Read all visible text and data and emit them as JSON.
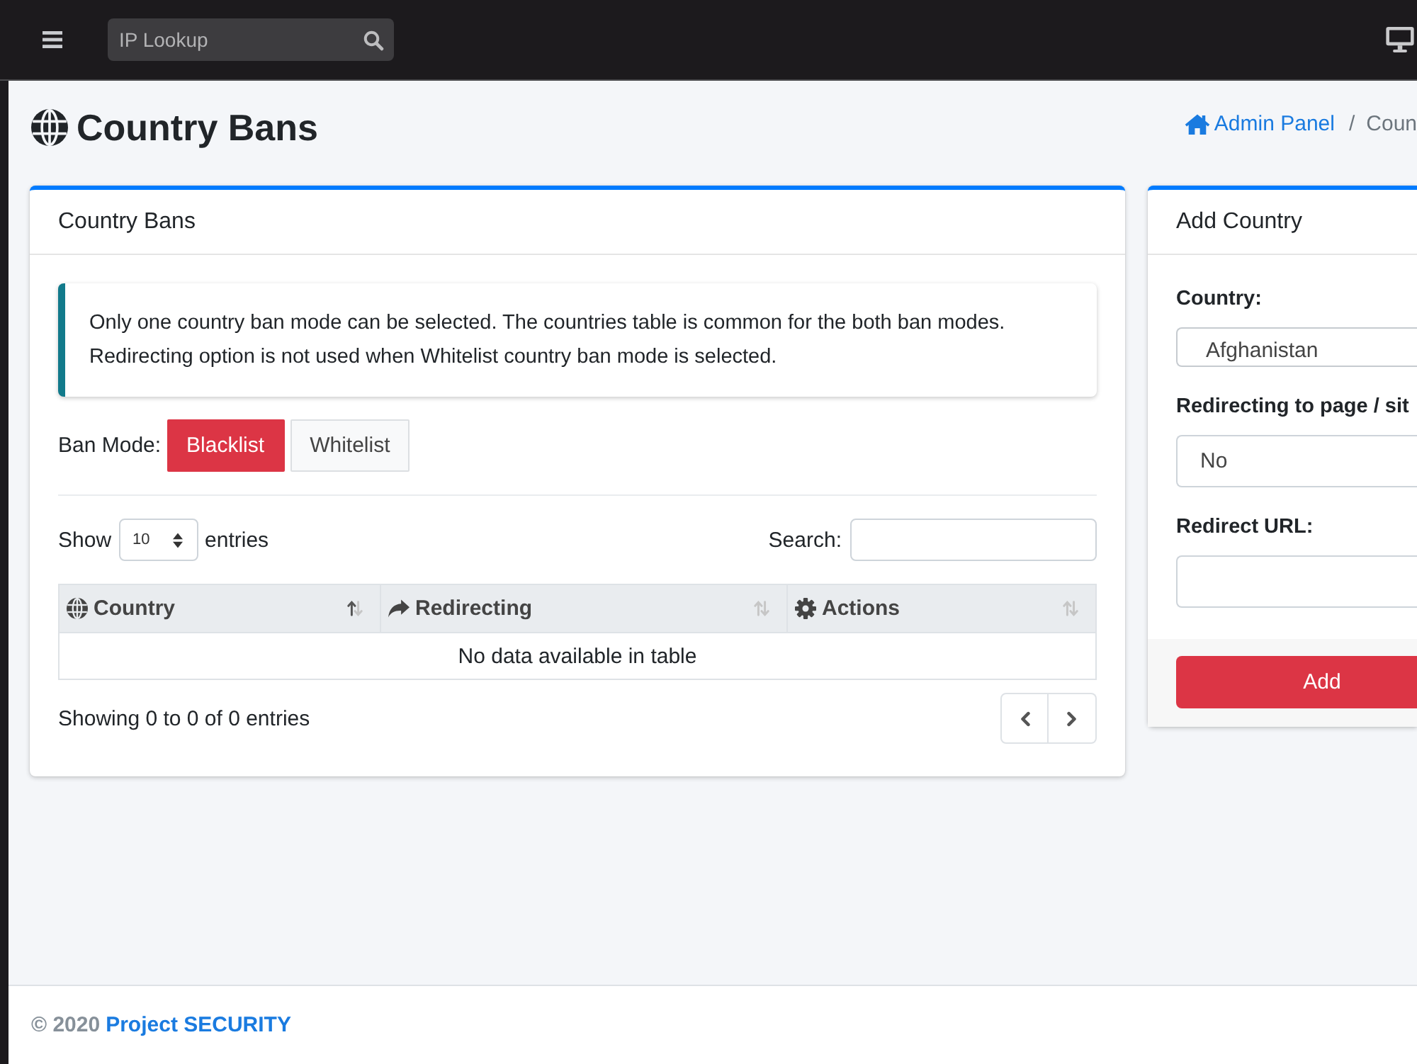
{
  "navbar": {
    "search": {
      "placeholder": "IP Lookup"
    }
  },
  "header": {
    "title": "Country Bans",
    "breadcrumb": {
      "separator": "/",
      "items": [
        {
          "label": "Admin Panel",
          "kind": "home"
        },
        {
          "label": "Coun",
          "kind": "current"
        }
      ]
    }
  },
  "bans_card": {
    "title": "Country Bans",
    "notice": "Only one country ban mode can be selected. The countries table is common for the both ban modes. Redirecting option is not used when Whitelist country ban mode is selected.",
    "ban_mode": {
      "label": "Ban Mode:",
      "options": [
        {
          "label": "Blacklist",
          "selected": true
        },
        {
          "label": "Whitelist",
          "selected": false
        }
      ]
    },
    "length": {
      "before": "Show",
      "value": "10",
      "after": "entries"
    },
    "search": {
      "label": "Search:"
    },
    "table": {
      "columns": [
        {
          "label": "Country",
          "sorted": true
        },
        {
          "label": "Redirecting",
          "sorted": false
        },
        {
          "label": "Actions",
          "sorted": false
        }
      ],
      "empty_message": "No data available in table"
    },
    "info": "Showing 0 to 0 of 0 entries"
  },
  "add_card": {
    "title": "Add Country",
    "fields": [
      {
        "label": "Country:",
        "kind": "combobox",
        "value": "Afghanistan"
      },
      {
        "label": "Redirecting to page / sit",
        "kind": "select",
        "value": "No"
      },
      {
        "label": "Redirect URL:",
        "kind": "text"
      }
    ],
    "submit": "Add"
  },
  "footer": {
    "copyright": "© 2020",
    "brand": "Project SECURITY"
  }
}
